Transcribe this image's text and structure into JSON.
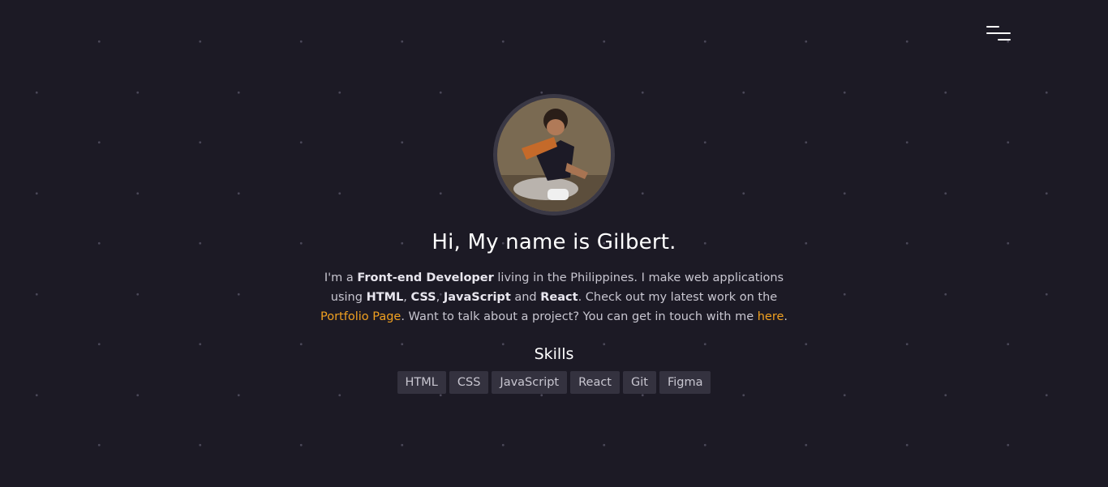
{
  "header": {
    "menu_icon": "hamburger-menu-icon"
  },
  "profile": {
    "avatar_alt": "Gilbert"
  },
  "intro": {
    "headline": "Hi, My name is Gilbert.",
    "bio": {
      "t1": "I'm a ",
      "role": "Front-end Developer",
      "t2": " living in the Philippines. I make web applications using ",
      "skill1": "HTML",
      "sep1": ", ",
      "skill2": "CSS",
      "sep2": ", ",
      "skill3": "JavaScript",
      "t3": " and ",
      "skill4": "React",
      "t4": ". Check out my latest work on the ",
      "portfolio_link": "Portfolio Page",
      "t5": ". Want to talk about a project? You can get in touch with me ",
      "contact_link": "here",
      "t6": "."
    }
  },
  "skills": {
    "title": "Skills",
    "items": [
      "HTML",
      "CSS",
      "JavaScript",
      "React",
      "Git",
      "Figma"
    ]
  },
  "colors": {
    "background": "#1c1a25",
    "accent": "#f0a020",
    "tag_bg": "#34323f"
  }
}
